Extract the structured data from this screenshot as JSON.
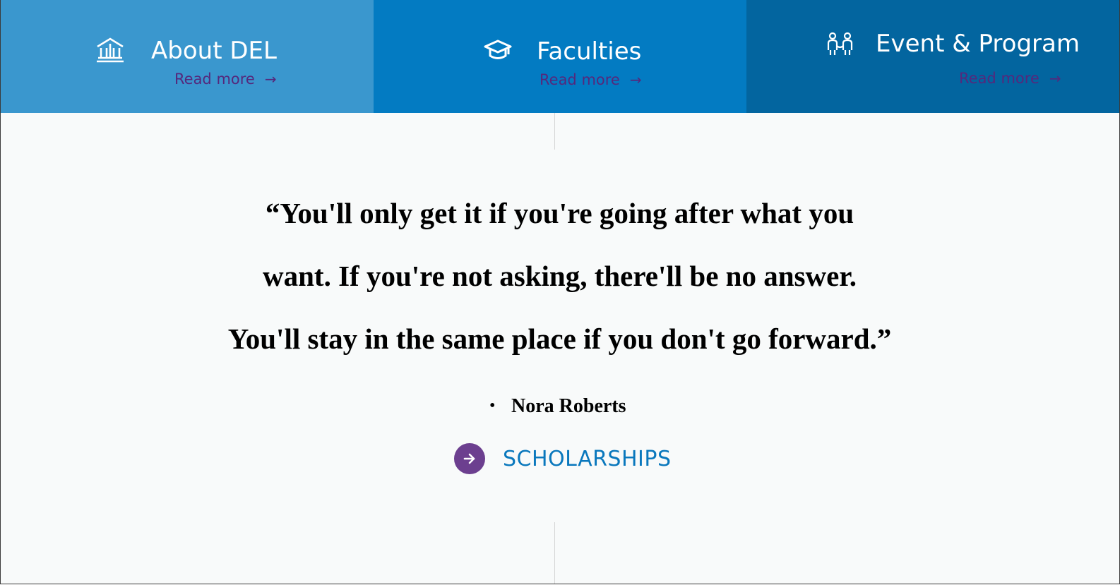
{
  "tiles": [
    {
      "title": "About DEL",
      "link": "Read more",
      "arrow": "→",
      "icon": "institution-building-icon",
      "bg": "#3a97ce"
    },
    {
      "title": "Faculties",
      "link": "Read more",
      "arrow": "→",
      "icon": "graduation-cap-icon",
      "bg": "#037bc2"
    },
    {
      "title": "Event & Program",
      "link": "Read more",
      "arrow": "→",
      "icon": "people-group-icon",
      "bg": "#03659f"
    }
  ],
  "quote": {
    "lines": [
      "“You'll only get it if you're going after what you",
      "want. If you're not asking, there'll be no answer.",
      "You'll stay in the same place if you don't go forward.”"
    ],
    "bullet": "•",
    "author": "Nora Roberts"
  },
  "cta": {
    "label": "SCHOLARSHIPS",
    "icon": "arrow-right-circle-icon"
  },
  "colors": {
    "link": "#55287c",
    "cta_circle": "#6c3f8f",
    "cta_text": "#0a78bd",
    "page_bg": "#f8fafa"
  }
}
